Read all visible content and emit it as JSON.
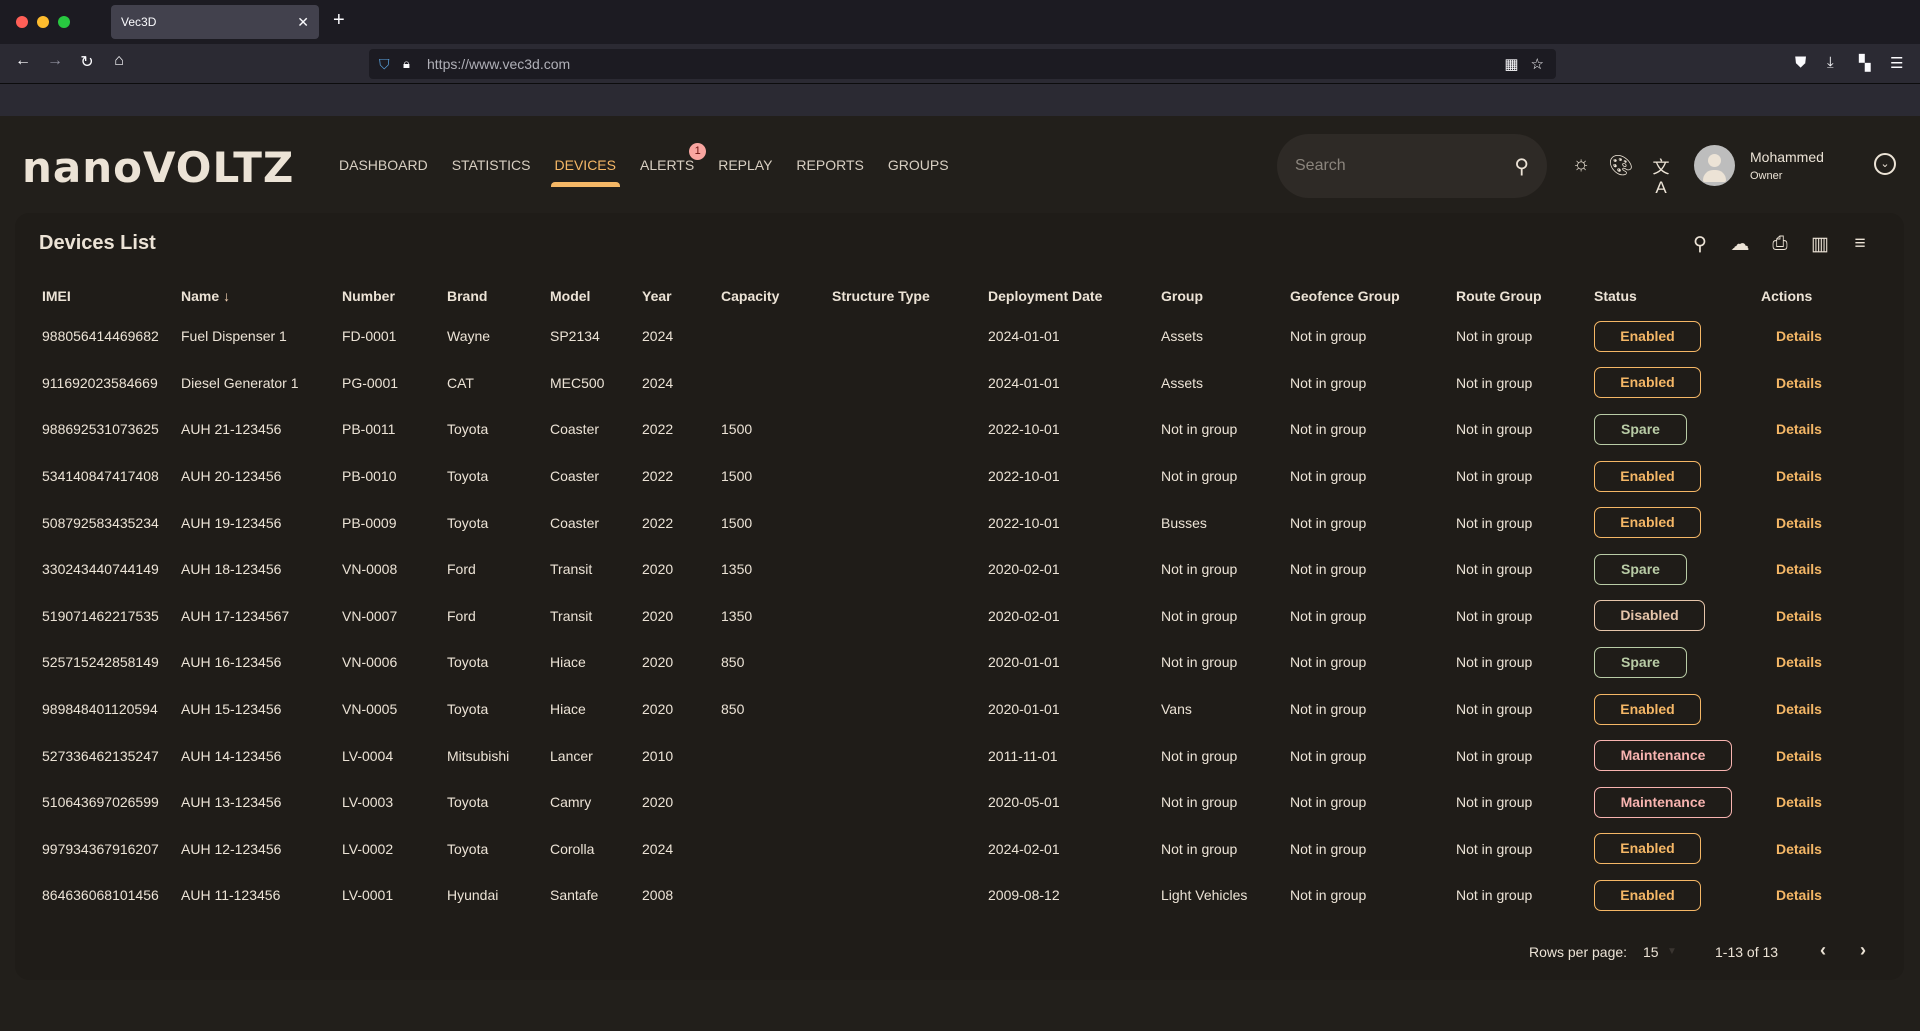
{
  "browser": {
    "tab_title": "Vec3D",
    "url": "https://www.vec3d.com",
    "icons": {
      "back": "arrow-left-icon",
      "forward": "arrow-right-icon",
      "reload": "reload-icon",
      "home": "home-icon",
      "shield": "shield-icon",
      "lock": "lock-icon",
      "qr": "qr-code-icon",
      "bookmark": "star-icon",
      "pocket": "pocket-icon",
      "downloads": "download-icon",
      "extensions": "extensions-icon",
      "menu": "hamburger-menu-icon"
    }
  },
  "app": {
    "logo": "nanoVOLTZ",
    "nav": [
      {
        "label": "DASHBOARD",
        "active": false
      },
      {
        "label": "STATISTICS",
        "active": false
      },
      {
        "label": "DEVICES",
        "active": true
      },
      {
        "label": "ALERTS",
        "active": false,
        "badge": "1"
      },
      {
        "label": "REPLAY",
        "active": false
      },
      {
        "label": "REPORTS",
        "active": false
      },
      {
        "label": "GROUPS",
        "active": false
      }
    ],
    "search_placeholder": "Search",
    "user": {
      "name": "Mohammed",
      "role": "Owner"
    },
    "accent_color": "#f5b766"
  },
  "devices": {
    "title": "Devices List",
    "toolbar_icons": [
      "search-icon",
      "cloud-download-icon",
      "print-icon",
      "columns-icon",
      "filter-icon"
    ],
    "columns": [
      "IMEI",
      "Name",
      "Number",
      "Brand",
      "Model",
      "Year",
      "Capacity",
      "Structure Type",
      "Deployment Date",
      "Group",
      "Geofence Group",
      "Route Group",
      "Status",
      "Actions"
    ],
    "sorted_column": "Name",
    "action_label": "Details",
    "rows": [
      {
        "imei": "988056414469682",
        "name": "Fuel Dispenser 1",
        "number": "FD-0001",
        "brand": "Wayne",
        "model": "SP2134",
        "year": "2024",
        "capacity": "",
        "structure": "",
        "deployment": "2024-01-01",
        "group": "Assets",
        "geofence": "Not in group",
        "route": "Not in group",
        "status": "Enabled"
      },
      {
        "imei": "911692023584669",
        "name": "Diesel Generator 1",
        "number": "PG-0001",
        "brand": "CAT",
        "model": "MEC500",
        "year": "2024",
        "capacity": "",
        "structure": "",
        "deployment": "2024-01-01",
        "group": "Assets",
        "geofence": "Not in group",
        "route": "Not in group",
        "status": "Enabled"
      },
      {
        "imei": "988692531073625",
        "name": "AUH 21-123456",
        "number": "PB-0011",
        "brand": "Toyota",
        "model": "Coaster",
        "year": "2022",
        "capacity": "1500",
        "structure": "",
        "deployment": "2022-10-01",
        "group": "Not in group",
        "geofence": "Not in group",
        "route": "Not in group",
        "status": "Spare"
      },
      {
        "imei": "534140847417408",
        "name": "AUH 20-123456",
        "number": "PB-0010",
        "brand": "Toyota",
        "model": "Coaster",
        "year": "2022",
        "capacity": "1500",
        "structure": "",
        "deployment": "2022-10-01",
        "group": "Not in group",
        "geofence": "Not in group",
        "route": "Not in group",
        "status": "Enabled"
      },
      {
        "imei": "508792583435234",
        "name": "AUH 19-123456",
        "number": "PB-0009",
        "brand": "Toyota",
        "model": "Coaster",
        "year": "2022",
        "capacity": "1500",
        "structure": "",
        "deployment": "2022-10-01",
        "group": "Busses",
        "geofence": "Not in group",
        "route": "Not in group",
        "status": "Enabled"
      },
      {
        "imei": "330243440744149",
        "name": "AUH 18-123456",
        "number": "VN-0008",
        "brand": "Ford",
        "model": "Transit",
        "year": "2020",
        "capacity": "1350",
        "structure": "",
        "deployment": "2020-02-01",
        "group": "Not in group",
        "geofence": "Not in group",
        "route": "Not in group",
        "status": "Spare"
      },
      {
        "imei": "519071462217535",
        "name": "AUH 17-1234567",
        "number": "VN-0007",
        "brand": "Ford",
        "model": "Transit",
        "year": "2020",
        "capacity": "1350",
        "structure": "",
        "deployment": "2020-02-01",
        "group": "Not in group",
        "geofence": "Not in group",
        "route": "Not in group",
        "status": "Disabled"
      },
      {
        "imei": "525715242858149",
        "name": "AUH 16-123456",
        "number": "VN-0006",
        "brand": "Toyota",
        "model": "Hiace",
        "year": "2020",
        "capacity": "850",
        "structure": "",
        "deployment": "2020-01-01",
        "group": "Not in group",
        "geofence": "Not in group",
        "route": "Not in group",
        "status": "Spare"
      },
      {
        "imei": "989848401120594",
        "name": "AUH 15-123456",
        "number": "VN-0005",
        "brand": "Toyota",
        "model": "Hiace",
        "year": "2020",
        "capacity": "850",
        "structure": "",
        "deployment": "2020-01-01",
        "group": "Vans",
        "geofence": "Not in group",
        "route": "Not in group",
        "status": "Enabled"
      },
      {
        "imei": "527336462135247",
        "name": "AUH 14-123456",
        "number": "LV-0004",
        "brand": "Mitsubishi",
        "model": "Lancer",
        "year": "2010",
        "capacity": "",
        "structure": "",
        "deployment": "2011-11-01",
        "group": "Not in group",
        "geofence": "Not in group",
        "route": "Not in group",
        "status": "Maintenance"
      },
      {
        "imei": "510643697026599",
        "name": "AUH 13-123456",
        "number": "LV-0003",
        "brand": "Toyota",
        "model": "Camry",
        "year": "2020",
        "capacity": "",
        "structure": "",
        "deployment": "2020-05-01",
        "group": "Not in group",
        "geofence": "Not in group",
        "route": "Not in group",
        "status": "Maintenance"
      },
      {
        "imei": "997934367916207",
        "name": "AUH 12-123456",
        "number": "LV-0002",
        "brand": "Toyota",
        "model": "Corolla",
        "year": "2024",
        "capacity": "",
        "structure": "",
        "deployment": "2024-02-01",
        "group": "Not in group",
        "geofence": "Not in group",
        "route": "Not in group",
        "status": "Enabled"
      },
      {
        "imei": "864636068101456",
        "name": "AUH 11-123456",
        "number": "LV-0001",
        "brand": "Hyundai",
        "model": "Santafe",
        "year": "2008",
        "capacity": "",
        "structure": "",
        "deployment": "2009-08-12",
        "group": "Light Vehicles",
        "geofence": "Not in group",
        "route": "Not in group",
        "status": "Enabled"
      }
    ],
    "status_colors": {
      "Enabled": "#f5b766",
      "Spare": "#b9cca6",
      "Disabled": "#e6c5aa",
      "Maintenance": "#f8b4b0"
    },
    "pagination": {
      "rows_per_page_label": "Rows per page:",
      "rows_per_page": "15",
      "range": "1-13 of 13"
    }
  }
}
